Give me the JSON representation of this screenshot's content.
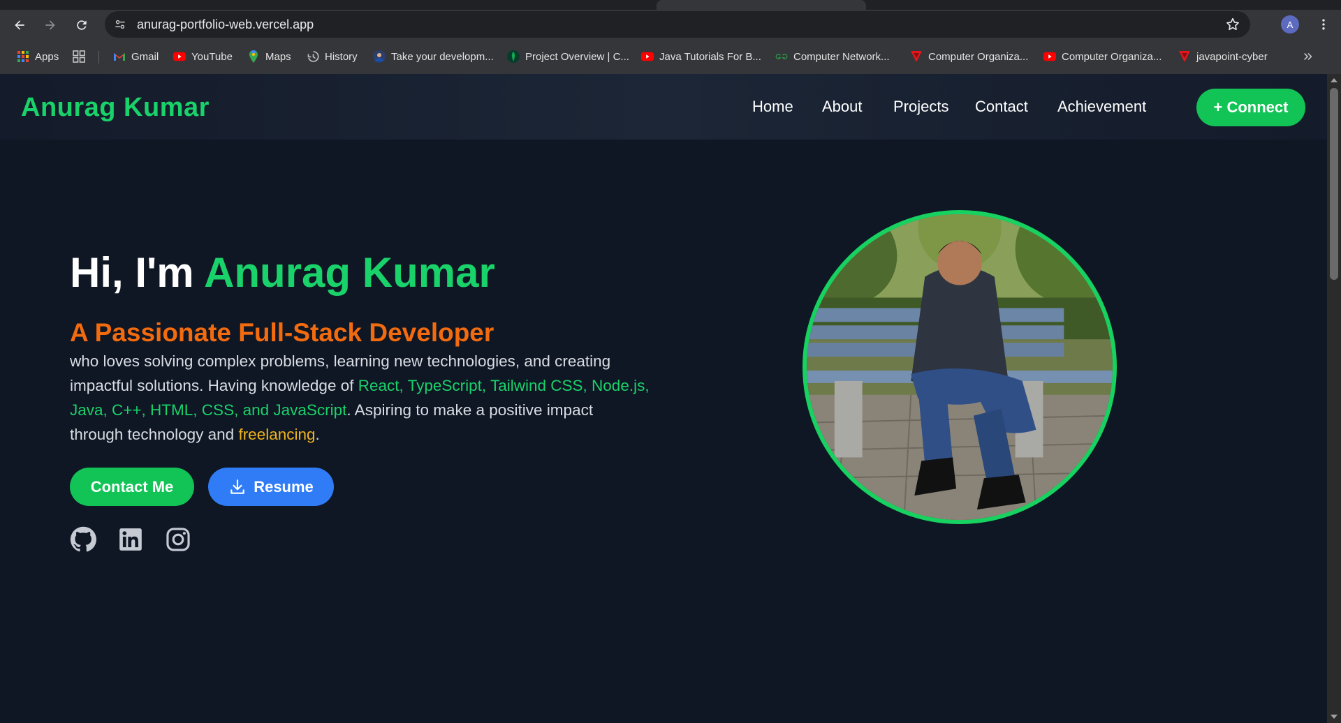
{
  "browser": {
    "url": "anurag-portfolio-web.vercel.app",
    "profile_initial": "A",
    "bookmarks": [
      {
        "label": "Apps",
        "icon": "apps-grid-icon"
      },
      {
        "label": "Gmail",
        "icon": "gmail-icon"
      },
      {
        "label": "YouTube",
        "icon": "youtube-icon"
      },
      {
        "label": "Maps",
        "icon": "maps-icon"
      },
      {
        "label": "History",
        "icon": "history-icon"
      },
      {
        "label": "Take your developm...",
        "icon": "avatar-favicon-icon"
      },
      {
        "label": "Project Overview | C...",
        "icon": "mongodb-icon"
      },
      {
        "label": "Java Tutorials For B...",
        "icon": "youtube-icon"
      },
      {
        "label": "Computer Network...",
        "icon": "gfg-icon"
      },
      {
        "label": "Computer Organiza...",
        "icon": "javatpoint-icon"
      },
      {
        "label": "Computer Organiza...",
        "icon": "youtube-icon"
      },
      {
        "label": "javapoint-cyber",
        "icon": "javatpoint-icon"
      }
    ]
  },
  "site": {
    "brand": "Anurag Kumar",
    "nav": [
      "Home",
      "About",
      "Projects",
      "Contact",
      "Achievement"
    ],
    "connect_label": "+ Connect"
  },
  "hero": {
    "greeting": "Hi, I'm ",
    "name": "Anurag Kumar",
    "subtitle": "A Passionate Full-Stack Developer",
    "desc_1": "who loves solving complex problems, learning new technologies, and creating impactful solutions. Having knowledge of ",
    "desc_skills": "React, TypeScript, Tailwind CSS, Node.js, Java, C++, HTML, CSS, and JavaScript",
    "desc_2": ". Aspiring to make a positive impact through technology and ",
    "desc_highlight": "freelancing",
    "desc_3": ".",
    "contact_label": "Contact Me",
    "resume_label": "Resume",
    "socials": [
      "github-icon",
      "linkedin-icon",
      "instagram-icon"
    ]
  },
  "colors": {
    "accent_green": "#1ad26a",
    "accent_orange": "#f26b0f",
    "accent_yellow": "#f1b41a",
    "accent_blue": "#2f7cf6",
    "background": "#0f1624"
  }
}
